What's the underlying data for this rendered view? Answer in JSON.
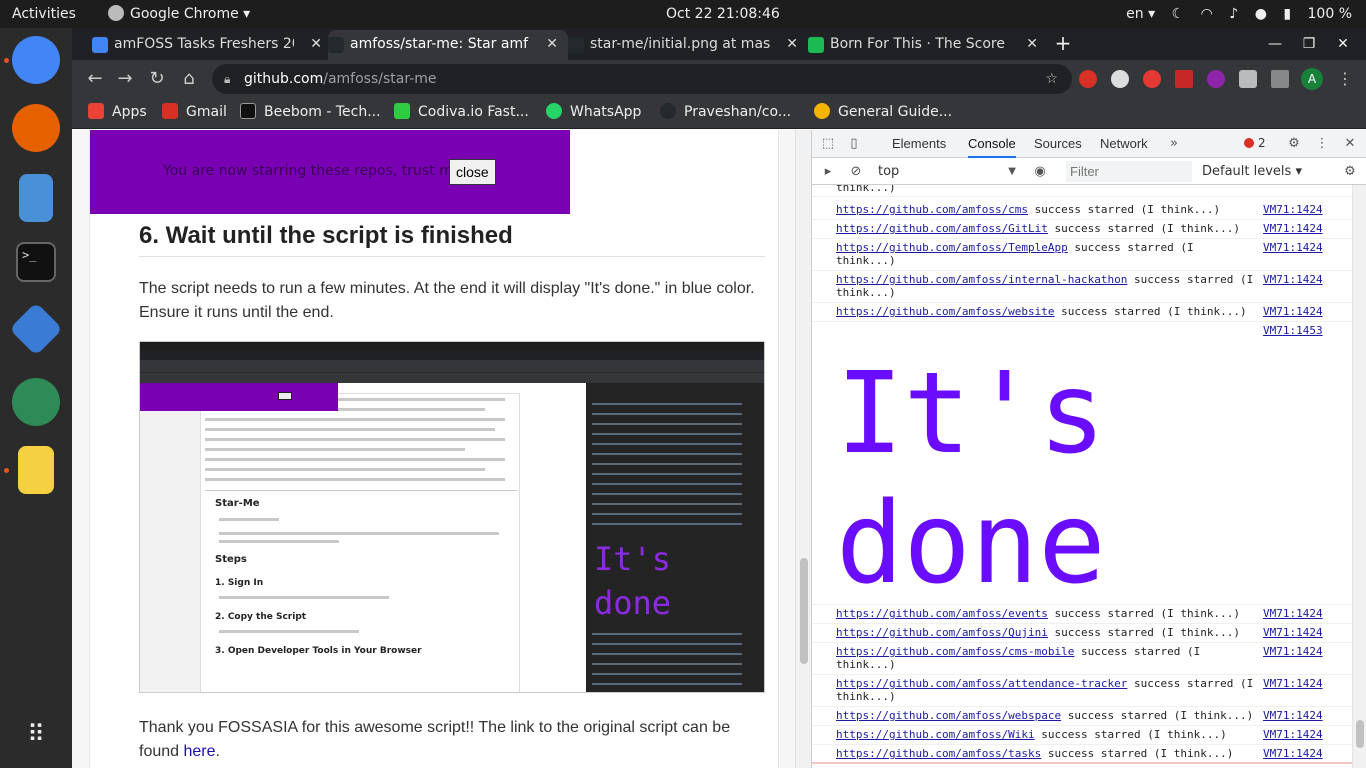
{
  "topbar": {
    "activities": "Activities",
    "app_name": "Google Chrome",
    "datetime": "Oct 22  21:08:46",
    "language": "en",
    "battery": "100 %"
  },
  "tabs": [
    {
      "title": "amFOSS Tasks Freshers 20",
      "favicon_color": "#4285f4"
    },
    {
      "title": "amfoss/star-me: Star amf",
      "favicon_color": "#24292e"
    },
    {
      "title": "star-me/initial.png at mas",
      "favicon_color": "#24292e"
    },
    {
      "title": "Born For This · The Score",
      "favicon_color": "#1db954"
    }
  ],
  "toolbar": {
    "url_host": "github.com",
    "url_path": "/amfoss/star-me",
    "profile_initial": "A"
  },
  "bookmarks": [
    {
      "label": "Apps",
      "color": "#ea4335"
    },
    {
      "label": "Gmail",
      "color": "#d93025"
    },
    {
      "label": "Beebom - Tech...",
      "color": "#111111"
    },
    {
      "label": "Codiva.io Fast...",
      "color": "#2ecc40"
    },
    {
      "label": "WhatsApp",
      "color": "#25d366"
    },
    {
      "label": "Praveshan/co...",
      "color": "#24292e"
    },
    {
      "label": "General Guide...",
      "color": "#f4b400"
    }
  ],
  "page": {
    "popup_message": "You are now starring these repos, trust me m",
    "popup_close": "close",
    "section_heading": "6. Wait until the script is finished",
    "para1": "The script needs to run a few minutes. At the end it will display \"It's done.\" in blue color. Ensure it runs until the end.",
    "para2_prefix": "Thank you FOSSASIA for this awesome script!! The link to the original script can be found ",
    "para2_link": "here",
    "para2_suffix": "."
  },
  "embedded": {
    "readme_title": "Star-Me",
    "steps_title": "Steps",
    "step1": "1. Sign In",
    "step2": "2. Copy the Script",
    "step3": "3. Open Developer Tools in Your Browser",
    "done_text": "It's\ndone"
  },
  "devtools": {
    "tabs": [
      "Elements",
      "Console",
      "Sources",
      "Network"
    ],
    "active_tab": "Console",
    "error_count": "2",
    "context": "top",
    "filter_placeholder": "Filter",
    "levels": "Default levels",
    "logs_before": [
      {
        "msg": "think...)",
        "src": ""
      },
      {
        "url": "https://github.com/amfoss/cms",
        "msg": " success starred (I think...)",
        "src": "VM71:1424"
      },
      {
        "url": "https://github.com/amfoss/GitLit",
        "msg": " success starred (I think...)",
        "src": "VM71:1424"
      },
      {
        "url": "https://github.com/amfoss/TempleApp",
        "msg": " success starred (I\nthink...)",
        "src": "VM71:1424"
      },
      {
        "url": "https://github.com/amfoss/internal-hackathon",
        "msg": " success starred (I\nthink...)",
        "src": "VM71:1424"
      },
      {
        "url": "https://github.com/amfoss/website",
        "msg": " success starred (I think...)",
        "src": "VM71:1424"
      }
    ],
    "done_src": "VM71:1453",
    "done_text": "It's\ndone",
    "logs_after": [
      {
        "url": "https://github.com/amfoss/events",
        "msg": " success starred (I think...)",
        "src": "VM71:1424"
      },
      {
        "url": "https://github.com/amfoss/Qujini",
        "msg": " success starred (I think...)",
        "src": "VM71:1424"
      },
      {
        "url": "https://github.com/amfoss/cms-mobile",
        "msg": " success starred (I\nthink...)",
        "src": "VM71:1424"
      },
      {
        "url": "https://github.com/amfoss/attendance-tracker",
        "msg": " success starred (I\nthink...)",
        "src": "VM71:1424"
      },
      {
        "url": "https://github.com/amfoss/webspace",
        "msg": " success starred (I think...)",
        "src": "VM71:1424"
      },
      {
        "url": "https://github.com/amfoss/Wiki",
        "msg": " success starred (I think...)",
        "src": "VM71:1424"
      },
      {
        "url": "https://github.com/amfoss/tasks",
        "msg": " success starred (I think...)",
        "src": "VM71:1424"
      }
    ]
  }
}
